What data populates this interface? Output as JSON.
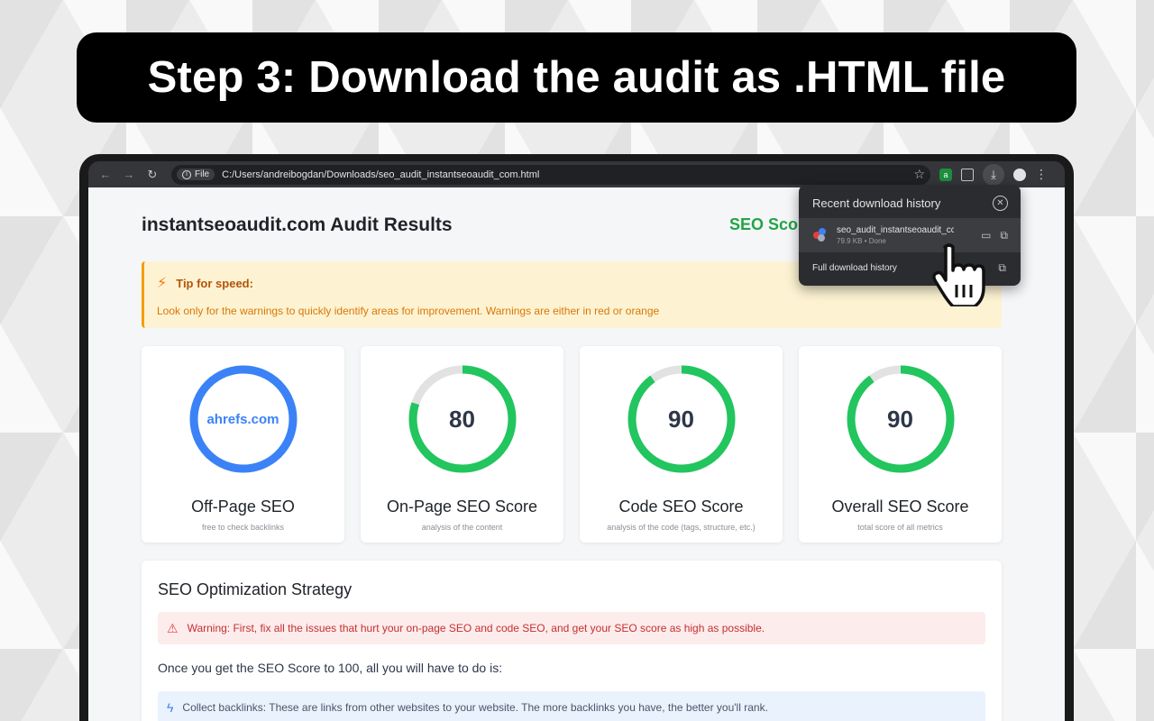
{
  "banner": {
    "title": "Step 3:  Download the audit as .HTML file"
  },
  "browser": {
    "nav": {
      "back": "←",
      "forward": "→",
      "reload": "↻"
    },
    "file_chip": "File",
    "url": "C:/Users/andreibogdan/Downloads/seo_audit_instantseoaudit_com.html",
    "icons": [
      "star-icon",
      "extension-icon",
      "puzzle-icon",
      "download-icon",
      "profile-icon",
      "menu-icon"
    ]
  },
  "page": {
    "title": "instantseoaudit.com Audit Results",
    "seo_score_label": "SEO Scor",
    "tip": {
      "heading": "Tip for speed:",
      "body": "Look only for the warnings to quickly identify areas for improvement. Warnings are either in red or orange"
    },
    "cards": [
      {
        "center": "ahrefs.com",
        "title": "Off-Page SEO",
        "sub": "free to check backlinks",
        "value": null
      },
      {
        "center": "80",
        "title": "On-Page SEO Score",
        "sub": "analysis of the content",
        "value": 80
      },
      {
        "center": "90",
        "title": "Code SEO Score",
        "sub": "analysis of the code (tags, structure, etc.)",
        "value": 90
      },
      {
        "center": "90",
        "title": "Overall SEO Score",
        "sub": "total score of all metrics",
        "value": 90
      }
    ],
    "strategy": {
      "title": "SEO Optimization Strategy",
      "warning": "Warning: First, fix all the issues that hurt your on-page SEO and code SEO, and get your SEO score as high as possible.",
      "text": "Once you get the SEO Score to 100, all you will have to do is:",
      "info": "Collect backlinks: These are links from other websites to your website. The more backlinks you have, the better you'll rank."
    }
  },
  "download_popup": {
    "title": "Recent download history",
    "file_name": "seo_audit_instantseoaudit_cc",
    "file_meta": "79.9 KB • Done",
    "full_history": "Full download history"
  },
  "colors": {
    "gauge_green": "#22c55e",
    "gauge_blue": "#3b82f6",
    "gauge_track": "#e2e2e2",
    "seo_green": "#22a447"
  }
}
